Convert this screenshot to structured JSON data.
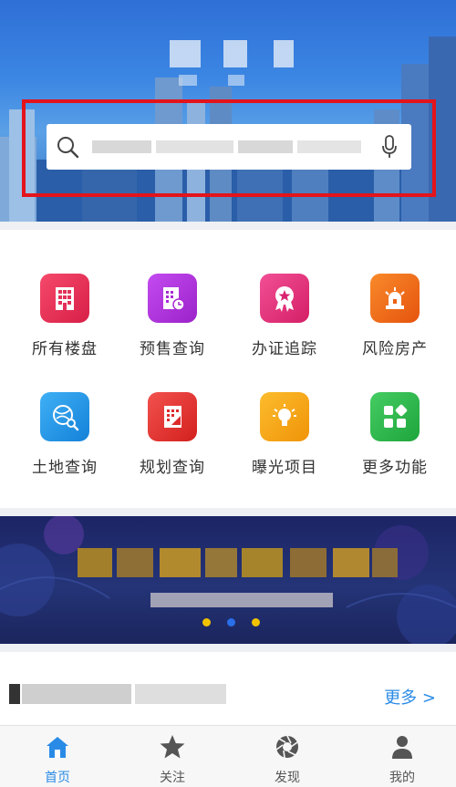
{
  "search": {
    "placeholder": ""
  },
  "features": [
    {
      "label": "所有楼盘",
      "icon": "building-icon",
      "color": "#e8315a"
    },
    {
      "label": "预售查询",
      "icon": "document-building-icon",
      "color": "#b030d8"
    },
    {
      "label": "办证追踪",
      "icon": "certificate-icon",
      "color": "#e8307a"
    },
    {
      "label": "风险房产",
      "icon": "alarm-icon",
      "color": "#f36b1c"
    },
    {
      "label": "土地查询",
      "icon": "globe-search-icon",
      "color": "#1a8fe0"
    },
    {
      "label": "规划查询",
      "icon": "plan-icon",
      "color": "#e83535"
    },
    {
      "label": "曝光项目",
      "icon": "lightbulb-icon",
      "color": "#f7a21a"
    },
    {
      "label": "更多功能",
      "icon": "grid-more-icon",
      "color": "#27b54a"
    }
  ],
  "banner": {
    "dots_colors": [
      "#f2c200",
      "#2a6fe8",
      "#f2c200"
    ]
  },
  "section": {
    "more_label": "更多 >"
  },
  "tabs": [
    {
      "label": "首页",
      "icon": "home-icon",
      "active": true
    },
    {
      "label": "关注",
      "icon": "star-icon",
      "active": false
    },
    {
      "label": "发现",
      "icon": "aperture-icon",
      "active": false
    },
    {
      "label": "我的",
      "icon": "person-icon",
      "active": false
    }
  ],
  "colors": {
    "accent": "#2a8be6",
    "highlight": "#e3141b"
  }
}
